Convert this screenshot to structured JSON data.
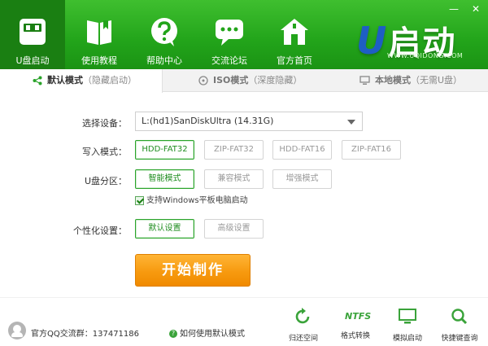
{
  "header": {
    "nav": [
      {
        "label": "U盘启动",
        "icon": "usb-drive-icon"
      },
      {
        "label": "使用教程",
        "icon": "book-icon"
      },
      {
        "label": "帮助中心",
        "icon": "help-icon"
      },
      {
        "label": "交流论坛",
        "icon": "chat-icon"
      },
      {
        "label": "官方首页",
        "icon": "home-icon"
      }
    ],
    "logo_text": "启动",
    "logo_u": "U",
    "logo_url": "WWW.UQIDONG.COM",
    "minimize": "—",
    "close": "✕"
  },
  "tabs": [
    {
      "title": "默认模式",
      "hint": "（隐藏启动）"
    },
    {
      "title": "ISO模式",
      "hint": "（深度隐藏）"
    },
    {
      "title": "本地模式",
      "hint": "（无需U盘）"
    }
  ],
  "form": {
    "device_label": "选择设备：",
    "device_value": "L:(hd1)SanDiskUltra (14.31G)",
    "write_label": "写入模式：",
    "write_options": [
      "HDD-FAT32",
      "ZIP-FAT32",
      "HDD-FAT16",
      "ZIP-FAT16"
    ],
    "partition_label": "U盘分区：",
    "partition_options": [
      "智能模式",
      "兼容模式",
      "增强模式"
    ],
    "tablet_checkbox": "支持Windows平板电脑启动",
    "personal_label": "个性化设置：",
    "personal_options": [
      "默认设置",
      "高级设置"
    ],
    "start_button": "开始制作"
  },
  "footer": {
    "qq_group": "官方QQ交流群：137471186",
    "help_link": "如何使用默认模式",
    "tools": [
      {
        "label": "归还空间",
        "icon": "restore-icon"
      },
      {
        "label": "格式转换",
        "icon": "ntfs-icon"
      },
      {
        "label": "模拟启动",
        "icon": "monitor-icon"
      },
      {
        "label": "快捷键查询",
        "icon": "search-icon"
      }
    ],
    "ntfs_text": "NTFS"
  },
  "colors": {
    "header_green": "#22a41a",
    "active_nav": "#1a7f12",
    "start_orange": "#f79a0f",
    "selected_green": "#2aa32a"
  }
}
